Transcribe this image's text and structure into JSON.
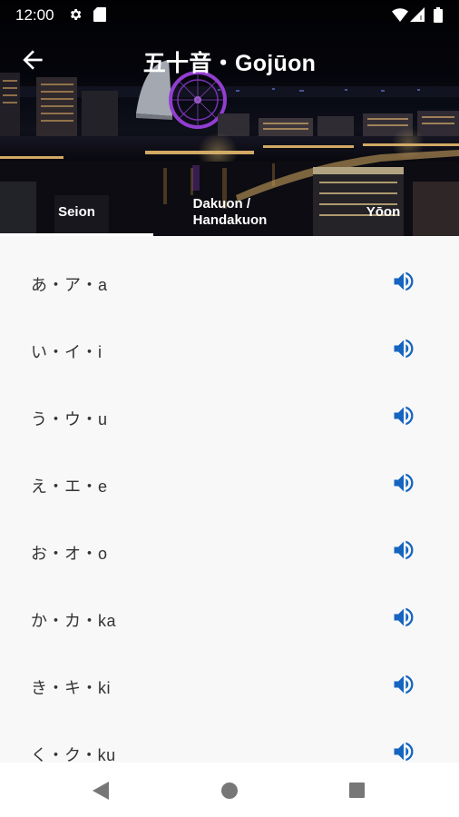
{
  "status_bar": {
    "time": "12:00",
    "icons": [
      "gear-icon",
      "sd-card-icon",
      "wifi-icon",
      "signal-icon",
      "battery-icon"
    ]
  },
  "app_bar": {
    "title": "五十音・Gojūon",
    "back_icon": "arrow-left-icon"
  },
  "tabs": [
    {
      "label": "Seion",
      "selected": true
    },
    {
      "label": "Dakuon / Handakuon",
      "line1": "Dakuon /",
      "line2": "Handakuon",
      "selected": false
    },
    {
      "label": "Yōon",
      "selected": false
    }
  ],
  "rows": [
    {
      "text": "あ・ア・a"
    },
    {
      "text": "い・イ・i"
    },
    {
      "text": "う・ウ・u"
    },
    {
      "text": "え・エ・e"
    },
    {
      "text": "お・オ・o"
    },
    {
      "text": "か・カ・ka"
    },
    {
      "text": "き・キ・ki"
    },
    {
      "text": "く・ク・ku"
    }
  ],
  "colors": {
    "accent": "#1565c0",
    "text": "#333333",
    "list_bg": "#f8f8f8"
  },
  "nav_bar": {
    "icons": [
      "nav-back-icon",
      "nav-home-icon",
      "nav-recents-icon"
    ]
  }
}
